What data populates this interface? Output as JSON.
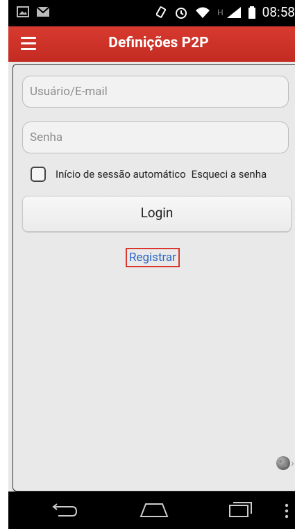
{
  "status_bar": {
    "time": "08:58",
    "h_indicator": "H"
  },
  "app_bar": {
    "title": "Definições P2P"
  },
  "form": {
    "username_placeholder": "Usuário/E-mail",
    "password_placeholder": "Senha",
    "auto_login_label": "Início de sessão automático",
    "forgot_password": "Esqueci a senha",
    "login_label": "Login",
    "register_label": "Registrar"
  },
  "colors": {
    "accent": "#d32f2f",
    "link": "#2d66c4"
  }
}
